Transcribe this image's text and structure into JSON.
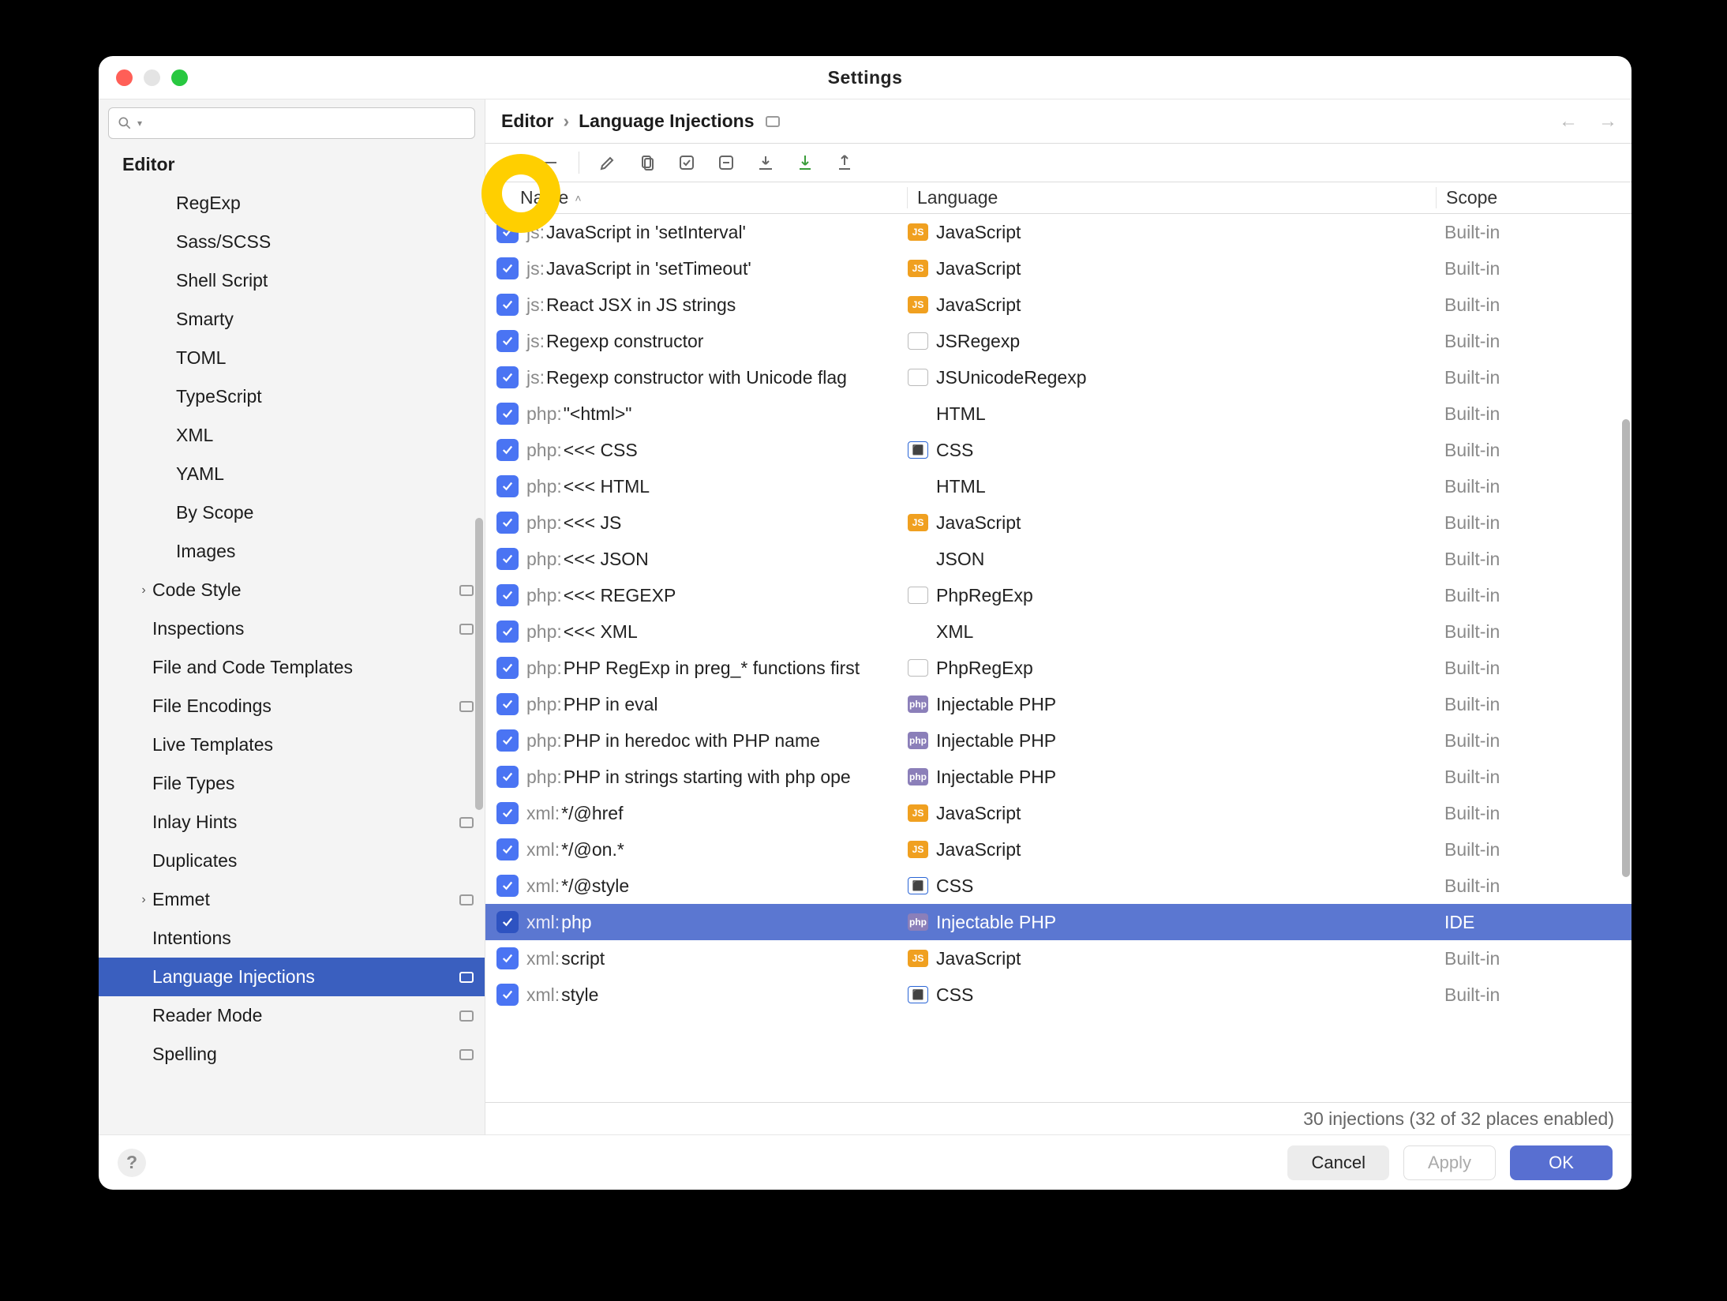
{
  "window": {
    "title": "Settings"
  },
  "breadcrumb": {
    "root": "Editor",
    "leaf": "Language Injections"
  },
  "search": {
    "placeholder": ""
  },
  "sidebar": {
    "root_label": "Editor",
    "items": [
      {
        "label": "RegExp",
        "indent": 98
      },
      {
        "label": "Sass/SCSS",
        "indent": 98
      },
      {
        "label": "Shell Script",
        "indent": 98
      },
      {
        "label": "Smarty",
        "indent": 98
      },
      {
        "label": "TOML",
        "indent": 98
      },
      {
        "label": "TypeScript",
        "indent": 98
      },
      {
        "label": "XML",
        "indent": 98
      },
      {
        "label": "YAML",
        "indent": 98
      },
      {
        "label": "By Scope",
        "indent": 98
      },
      {
        "label": "Images",
        "indent": 98
      },
      {
        "label": "Code Style",
        "indent": 68,
        "chevron": true,
        "modified": true
      },
      {
        "label": "Inspections",
        "indent": 68,
        "modified": true
      },
      {
        "label": "File and Code Templates",
        "indent": 68
      },
      {
        "label": "File Encodings",
        "indent": 68,
        "modified": true
      },
      {
        "label": "Live Templates",
        "indent": 68
      },
      {
        "label": "File Types",
        "indent": 68
      },
      {
        "label": "Inlay Hints",
        "indent": 68,
        "modified": true
      },
      {
        "label": "Duplicates",
        "indent": 68
      },
      {
        "label": "Emmet",
        "indent": 68,
        "chevron": true,
        "modified": true
      },
      {
        "label": "Intentions",
        "indent": 68
      },
      {
        "label": "Language Injections",
        "indent": 68,
        "selected": true,
        "modified": true
      },
      {
        "label": "Reader Mode",
        "indent": 68,
        "modified": true
      },
      {
        "label": "Spelling",
        "indent": 68,
        "modified": true
      }
    ]
  },
  "columns": {
    "name": "Name",
    "language": "Language",
    "scope": "Scope"
  },
  "rows": [
    {
      "prefix": "js: ",
      "name": "JavaScript in 'setInterval'",
      "icon": "JS",
      "iconClass": "ic-js",
      "lang": "JavaScript",
      "scope": "Built-in"
    },
    {
      "prefix": "js: ",
      "name": "JavaScript in 'setTimeout'",
      "icon": "JS",
      "iconClass": "ic-js",
      "lang": "JavaScript",
      "scope": "Built-in"
    },
    {
      "prefix": "js: ",
      "name": "React JSX in JS strings",
      "icon": "JS",
      "iconClass": "ic-js",
      "lang": "JavaScript",
      "scope": "Built-in"
    },
    {
      "prefix": "js: ",
      "name": "Regexp constructor",
      "icon": ".*",
      "iconClass": "ic-jsre",
      "lang": "JSRegexp",
      "scope": "Built-in"
    },
    {
      "prefix": "js: ",
      "name": "Regexp constructor with Unicode flag",
      "icon": ".*",
      "iconClass": "ic-jsre",
      "lang": "JSUnicodeRegexp",
      "scope": "Built-in"
    },
    {
      "prefix": "php: ",
      "name": "\"<html>\"",
      "icon": "<>",
      "iconClass": "ic-html",
      "lang": "HTML",
      "scope": "Built-in"
    },
    {
      "prefix": "php: ",
      "name": "<<< CSS",
      "icon": "⬛",
      "iconClass": "ic-css",
      "lang": "CSS",
      "scope": "Built-in"
    },
    {
      "prefix": "php: ",
      "name": "<<< HTML",
      "icon": "<>",
      "iconClass": "ic-html",
      "lang": "HTML",
      "scope": "Built-in"
    },
    {
      "prefix": "php: ",
      "name": "<<< JS",
      "icon": "JS",
      "iconClass": "ic-js",
      "lang": "JavaScript",
      "scope": "Built-in"
    },
    {
      "prefix": "php: ",
      "name": "<<< JSON",
      "icon": "{}",
      "iconClass": "ic-json",
      "lang": "JSON",
      "scope": "Built-in"
    },
    {
      "prefix": "php: ",
      "name": "<<< REGEXP",
      "icon": ".*",
      "iconClass": "ic-jsre",
      "lang": "PhpRegExp",
      "scope": "Built-in"
    },
    {
      "prefix": "php: ",
      "name": "<<< XML",
      "icon": "</>",
      "iconClass": "ic-xml",
      "lang": "XML",
      "scope": "Built-in"
    },
    {
      "prefix": "php: ",
      "name": "PHP RegExp in preg_* functions first",
      "icon": ".*",
      "iconClass": "ic-jsre",
      "lang": "PhpRegExp",
      "scope": "Built-in"
    },
    {
      "prefix": "php: ",
      "name": "PHP in eval",
      "icon": "php",
      "iconClass": "ic-php",
      "lang": "Injectable PHP",
      "scope": "Built-in"
    },
    {
      "prefix": "php: ",
      "name": "PHP in heredoc with PHP name",
      "icon": "php",
      "iconClass": "ic-php",
      "lang": "Injectable PHP",
      "scope": "Built-in"
    },
    {
      "prefix": "php: ",
      "name": "PHP in strings starting with php ope",
      "icon": "php",
      "iconClass": "ic-php",
      "lang": "Injectable PHP",
      "scope": "Built-in"
    },
    {
      "prefix": "xml: ",
      "name": "*/@href",
      "icon": "JS",
      "iconClass": "ic-js",
      "lang": "JavaScript",
      "scope": "Built-in"
    },
    {
      "prefix": "xml: ",
      "name": "*/@on.*",
      "icon": "JS",
      "iconClass": "ic-js",
      "lang": "JavaScript",
      "scope": "Built-in"
    },
    {
      "prefix": "xml: ",
      "name": "*/@style",
      "icon": "⬛",
      "iconClass": "ic-css",
      "lang": "CSS",
      "scope": "Built-in"
    },
    {
      "prefix": "xml: ",
      "name": "php",
      "icon": "php",
      "iconClass": "ic-php",
      "lang": "Injectable PHP",
      "scope": "IDE",
      "selected": true
    },
    {
      "prefix": "xml: ",
      "name": "script",
      "icon": "JS",
      "iconClass": "ic-js",
      "lang": "JavaScript",
      "scope": "Built-in"
    },
    {
      "prefix": "xml: ",
      "name": "style",
      "icon": "⬛",
      "iconClass": "ic-css",
      "lang": "CSS",
      "scope": "Built-in"
    }
  ],
  "status": "30 injections (32 of 32 places enabled)",
  "footer": {
    "cancel": "Cancel",
    "apply": "Apply",
    "ok": "OK"
  }
}
